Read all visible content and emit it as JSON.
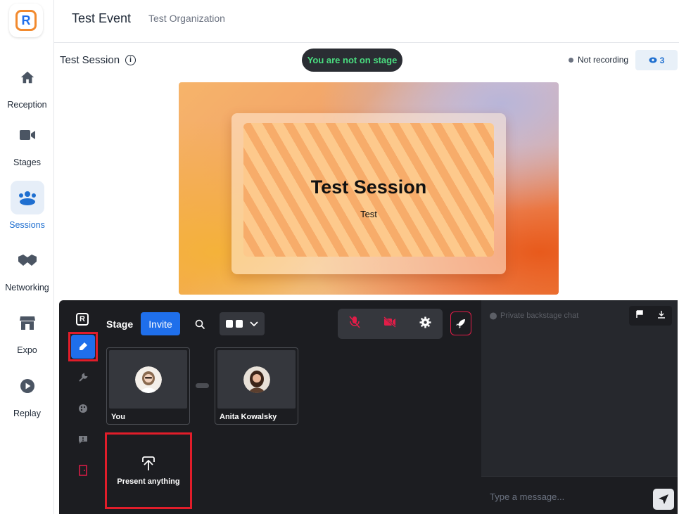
{
  "nav": {
    "items": [
      {
        "label": "Reception",
        "icon": "home-icon"
      },
      {
        "label": "Stages",
        "icon": "video-camera-icon"
      },
      {
        "label": "Sessions",
        "icon": "people-group-icon",
        "active": true
      },
      {
        "label": "Networking",
        "icon": "handshake-icon"
      },
      {
        "label": "Expo",
        "icon": "storefront-icon"
      },
      {
        "label": "Replay",
        "icon": "play-circle-icon"
      }
    ]
  },
  "header": {
    "event_title": "Test Event",
    "organization": "Test Organization"
  },
  "session": {
    "title": "Test Session",
    "stage_status": "You are not on stage",
    "recording_status": "Not recording",
    "viewer_count": "3"
  },
  "slide": {
    "title": "Test Session",
    "subtitle": "Test"
  },
  "backstage": {
    "stage_label": "Stage",
    "invite_label": "Invite",
    "participants": [
      {
        "name": "You"
      },
      {
        "name": "Anita Kowalsky"
      }
    ],
    "present_label": "Present anything",
    "chat_title": "Private backstage chat",
    "chat_placeholder": "Type a message..."
  },
  "colors": {
    "accent": "#1f6feb",
    "on_stage_text": "#4ade80",
    "highlight": "#e11d2a"
  }
}
